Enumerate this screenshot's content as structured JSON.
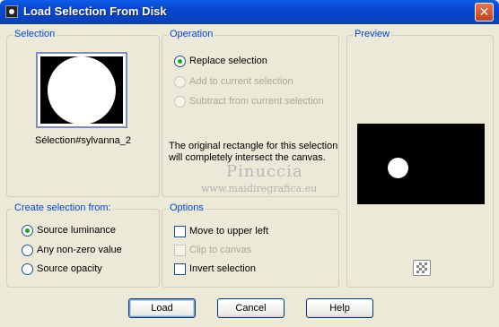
{
  "window": {
    "title": "Load Selection From Disk",
    "close_symbol": "✕"
  },
  "selection": {
    "group_title": "Selection",
    "name": "Sélection#sylvanna_2"
  },
  "operation": {
    "group_title": "Operation",
    "options": [
      {
        "label": "Replace selection",
        "checked": true,
        "enabled": true
      },
      {
        "label": "Add to current selection",
        "checked": false,
        "enabled": false
      },
      {
        "label": "Subtract from current selection",
        "checked": false,
        "enabled": false
      }
    ],
    "info": "The original rectangle for this selection will completely intersect the canvas."
  },
  "watermark": {
    "name": "Pinuccia",
    "url": "www.maidiregrafica.eu"
  },
  "preview": {
    "group_title": "Preview"
  },
  "create_from": {
    "group_title": "Create selection from:",
    "options": [
      {
        "label": "Source luminance",
        "checked": true
      },
      {
        "label": "Any non-zero value",
        "checked": false
      },
      {
        "label": "Source opacity",
        "checked": false
      }
    ]
  },
  "options": {
    "group_title": "Options",
    "items": [
      {
        "label": "Move to upper left",
        "checked": false,
        "enabled": true
      },
      {
        "label": "Clip to canvas",
        "checked": false,
        "enabled": false
      },
      {
        "label": "Invert selection",
        "checked": false,
        "enabled": true
      }
    ]
  },
  "buttons": {
    "load": "Load",
    "cancel": "Cancel",
    "help": "Help"
  }
}
